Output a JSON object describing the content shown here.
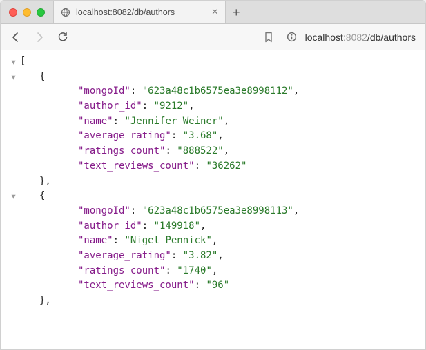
{
  "tab": {
    "title": "localhost:8082/db/authors",
    "close_glyph": "×",
    "new_tab_glyph": "+"
  },
  "address": {
    "host": "localhost",
    "port": ":8082",
    "path": "/db/authors"
  },
  "json": {
    "open_bracket": "[",
    "open_brace": "{",
    "close_brace_comma": "},",
    "records": [
      {
        "fields": [
          {
            "key": "mongoId",
            "value": "623a48c1b6575ea3e8998112"
          },
          {
            "key": "author_id",
            "value": "9212"
          },
          {
            "key": "name",
            "value": "Jennifer Weiner"
          },
          {
            "key": "average_rating",
            "value": "3.68"
          },
          {
            "key": "ratings_count",
            "value": "888522"
          },
          {
            "key": "text_reviews_count",
            "value": "36262"
          }
        ]
      },
      {
        "fields": [
          {
            "key": "mongoId",
            "value": "623a48c1b6575ea3e8998113"
          },
          {
            "key": "author_id",
            "value": "149918"
          },
          {
            "key": "name",
            "value": "Nigel Pennick"
          },
          {
            "key": "average_rating",
            "value": "3.82"
          },
          {
            "key": "ratings_count",
            "value": "1740"
          },
          {
            "key": "text_reviews_count",
            "value": "96"
          }
        ]
      }
    ]
  }
}
